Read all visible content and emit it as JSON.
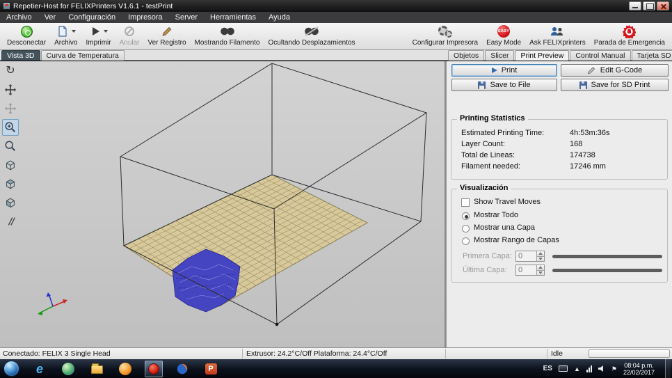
{
  "titlebar": {
    "title": "Repetier-Host for FELIXPrinters V1.6.1 - testPrint"
  },
  "menubar": {
    "items": [
      "Archivo",
      "Ver",
      "Configuración",
      "Impresora",
      "Server",
      "Herramientas",
      "Ayuda"
    ]
  },
  "toolbar": {
    "buttons": [
      "Desconectar",
      "Archivo",
      "Imprimir",
      "Anular",
      "Ver Registro",
      "Mostrando Filamento",
      "Ocultando Desplazamientos"
    ],
    "right_buttons": [
      "Configurar Impresora",
      "Easy Mode",
      "Ask FELIXprinters",
      "Parada de Emergencia"
    ],
    "easy_badge": "EASY"
  },
  "left_panel": {
    "tabs": [
      "Vista 3D",
      "Curva de Temperatura"
    ],
    "active_tab": "Vista 3D"
  },
  "right_panel": {
    "tabs": [
      "Objetos",
      "Slicer",
      "Print Preview",
      "Control Manual",
      "Tarjeta SD"
    ],
    "active_tab": "Print Preview",
    "buttons": {
      "print": "Print",
      "edit_gcode": "Edit G-Code",
      "save_to_file": "Save to File",
      "save_for_sd": "Save for SD Print"
    },
    "statistics": {
      "title": "Printing Statistics",
      "rows": [
        {
          "label": "Estimated Printing Time:",
          "value": "4h:53m:36s"
        },
        {
          "label": "Layer Count:",
          "value": "168"
        },
        {
          "label": "Total de Lineas:",
          "value": "174738"
        },
        {
          "label": "Filament needed:",
          "value": "17246 mm"
        }
      ]
    },
    "visualization": {
      "title": "Visualización",
      "travel_moves": {
        "label": "Show Travel Moves",
        "checked": false
      },
      "radios": [
        {
          "label": "Mostrar Todo",
          "selected": true
        },
        {
          "label": "Mostrar una Capa",
          "selected": false
        },
        {
          "label": "Mostrar Rango de Capas",
          "selected": false
        }
      ],
      "first_layer": {
        "label": "Primera Capa:",
        "value": "0"
      },
      "last_layer": {
        "label": "Última Capa:",
        "value": "0"
      }
    }
  },
  "statusbar": {
    "connection": "Conectado: FELIX 3 Single Head",
    "temperatures": "Extrusor: 24.2°C/Off Plataforma: 24.4°C/Off",
    "state": "Idle"
  },
  "taskbar": {
    "language": "ES",
    "time": "08:04 p.m.",
    "date": "22/02/2017"
  },
  "icons": {
    "rotate": "↻",
    "ie_e": "e",
    "powerpoint_p": "P",
    "tray_expand": "▲",
    "tray_flag": "⚑"
  },
  "colors": {
    "bed": "#d8c99b",
    "object": "#4545c2",
    "easy_red": "#d6161d",
    "focus_blue": "#3f7cb1"
  }
}
